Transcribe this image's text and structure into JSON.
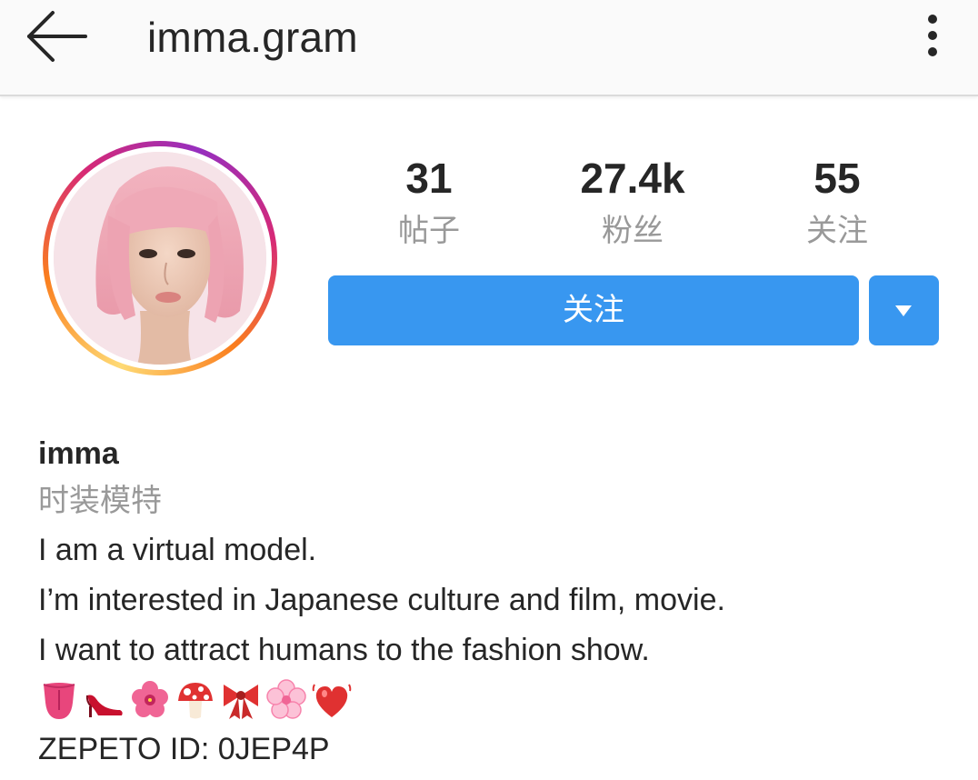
{
  "header": {
    "title": "imma.gram",
    "back_icon": "arrow-left-icon",
    "more_icon": "more-vertical-icon"
  },
  "profile": {
    "avatar": "profile-avatar",
    "stats": [
      {
        "value": "31",
        "label": "帖子"
      },
      {
        "value": "27.4k",
        "label": "粉丝"
      },
      {
        "value": "55",
        "label": "关注"
      }
    ],
    "follow_label": "关注",
    "dropdown_icon": "triangle-down-icon"
  },
  "bio": {
    "name": "imma",
    "category": "时装模特",
    "lines": [
      "I am a virtual model.",
      "I’m interested in Japanese culture and film, movie.",
      "I want to attract humans to the fashion show."
    ],
    "emojis": [
      "tongue-icon",
      "high-heel-icon",
      "hibiscus-icon",
      "mushroom-icon",
      "ribbon-icon",
      "cherry-blossom-icon",
      "beating-heart-icon"
    ],
    "zepeto": "ZEPETO ID: 0JEP4P"
  },
  "colors": {
    "accent": "#3897f0",
    "text": "#262626",
    "muted": "#999999",
    "topbar": "#fafafa"
  }
}
